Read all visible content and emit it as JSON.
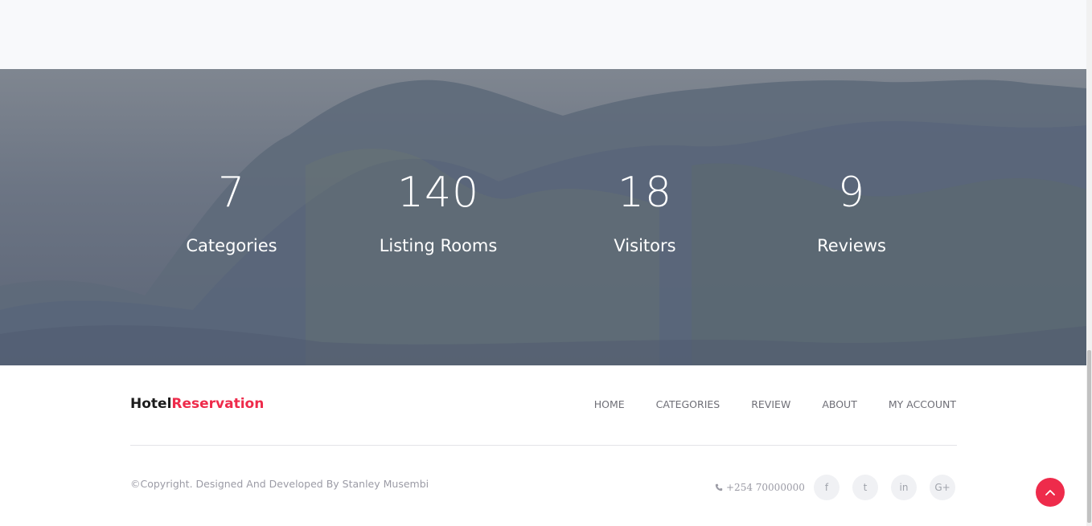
{
  "stats": [
    {
      "value": "7",
      "label": "Categories"
    },
    {
      "value": "140",
      "label": "Listing Rooms"
    },
    {
      "value": "18",
      "label": "Visitors"
    },
    {
      "value": "9",
      "label": "Reviews"
    }
  ],
  "footer": {
    "brand_part1": "Hotel",
    "brand_part2": "Reservation",
    "nav": [
      "HOME",
      "CATEGORIES",
      "REVIEW",
      "ABOUT",
      "MY ACCOUNT"
    ],
    "copyright": "©Copyright. Designed And Developed By Stanley Musembi",
    "phone": "+254 70000000",
    "social": [
      {
        "icon": "facebook-icon",
        "glyph": "f"
      },
      {
        "icon": "twitter-icon",
        "glyph": "t"
      },
      {
        "icon": "linkedin-icon",
        "glyph": "in"
      },
      {
        "icon": "google-plus-icon",
        "glyph": "G+"
      }
    ]
  },
  "colors": {
    "accent": "#ee2b4b",
    "brand_dark": "#1c1c1c",
    "muted": "#9b9ba5"
  }
}
